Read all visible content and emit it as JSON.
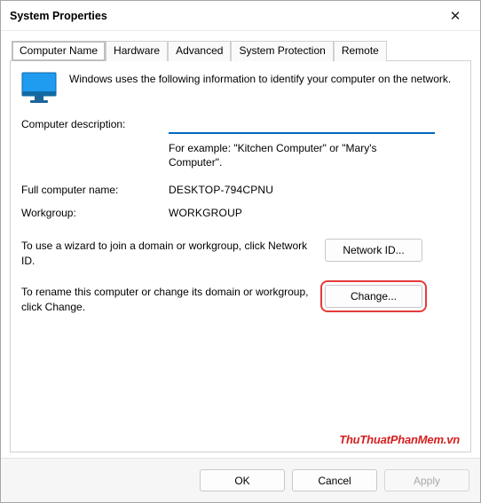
{
  "window": {
    "title": "System Properties",
    "close_symbol": "✕"
  },
  "tabs": [
    {
      "label": "Computer Name",
      "active": true,
      "highlighted": true
    },
    {
      "label": "Hardware",
      "active": false,
      "highlighted": false
    },
    {
      "label": "Advanced",
      "active": false,
      "highlighted": false
    },
    {
      "label": "System Protection",
      "active": false,
      "highlighted": false
    },
    {
      "label": "Remote",
      "active": false,
      "highlighted": false
    }
  ],
  "panel": {
    "intro": "Windows uses the following information to identify your computer on the network.",
    "desc_label": "Computer description:",
    "desc_value": "",
    "desc_example": "For example: \"Kitchen Computer\" or \"Mary's Computer\".",
    "full_name_label": "Full computer name:",
    "full_name_value": "DESKTOP-794CPNU",
    "workgroup_label": "Workgroup:",
    "workgroup_value": "WORKGROUP",
    "network_id_desc": "To use a wizard to join a domain or workgroup, click Network ID.",
    "network_id_btn": "Network ID...",
    "change_desc": "To rename this computer or change its domain or workgroup, click Change.",
    "change_btn": "Change...",
    "watermark": "ThuThuatPhanMem.vn"
  },
  "footer": {
    "ok": "OK",
    "cancel": "Cancel",
    "apply": "Apply"
  }
}
